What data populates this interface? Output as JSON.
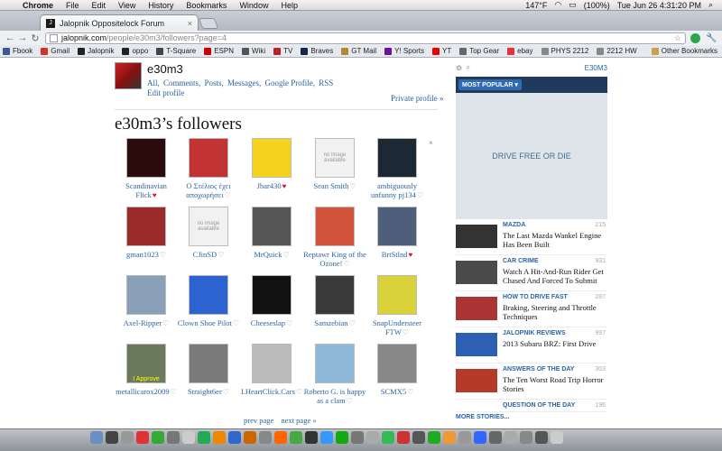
{
  "menubar": {
    "app": "Chrome",
    "menus": [
      "File",
      "Edit",
      "View",
      "History",
      "Bookmarks",
      "Window",
      "Help"
    ],
    "temp": "147°F",
    "battery": "(100%)",
    "clock": "Tue Jun 26  4:31:20 PM"
  },
  "tab": {
    "title": "Jalopnik Oppositelock Forum"
  },
  "address": {
    "host": "jalopnik.com",
    "path": "/people/e30m3/followers?page=4"
  },
  "bookmarks": [
    {
      "label": "Fbook",
      "color": "#3b5998"
    },
    {
      "label": "Gmail",
      "color": "#d93025"
    },
    {
      "label": "Jalopnik",
      "color": "#222"
    },
    {
      "label": "oppo",
      "color": "#222"
    },
    {
      "label": "T-Square",
      "color": "#444"
    },
    {
      "label": "ESPN",
      "color": "#c00"
    },
    {
      "label": "Wiki",
      "color": "#555"
    },
    {
      "label": "TV",
      "color": "#b22"
    },
    {
      "label": "Braves",
      "color": "#13274f"
    },
    {
      "label": "GT Mail",
      "color": "#b08a2e"
    },
    {
      "label": "Y! Sports",
      "color": "#720e9e"
    },
    {
      "label": "YT",
      "color": "#e00"
    },
    {
      "label": "Top Gear",
      "color": "#666"
    },
    {
      "label": "ebay",
      "color": "#e53238"
    },
    {
      "label": "PHYS 2212",
      "color": "#888"
    },
    {
      "label": "2212 HW",
      "color": "#888"
    }
  ],
  "other_bookmarks": "Other Bookmarks",
  "profile": {
    "username": "e30m3",
    "links": [
      "All,",
      "Comments,",
      "Posts,",
      "Messages,",
      "Google Profile,",
      "RSS"
    ],
    "edit": "Edit profile",
    "private": "Private profile »"
  },
  "page_title": "e30m3’s followers",
  "followers": [
    {
      "name": "Scandinavian Flick",
      "heart": "red",
      "img": "#2b0b0b"
    },
    {
      "name": "Ο Στέλιος έχει αποχωρήσει",
      "heart": "empty",
      "img": "#c23434"
    },
    {
      "name": "Jbar430",
      "heart": "red",
      "img": "#f4d21d"
    },
    {
      "name": "Sean Smith",
      "heart": "empty",
      "img": "#f1f1f1",
      "placeholder": "no image available"
    },
    {
      "name": "ambiguously unfunny pj134",
      "heart": "empty",
      "img": "#1c2834"
    },
    {
      "name": "gman1023",
      "heart": "empty",
      "img": "#9b2a2a"
    },
    {
      "name": "CJinSD",
      "heart": "empty",
      "img": "#f1f1f1",
      "placeholder": "no image available"
    },
    {
      "name": "MrQuick",
      "heart": "empty",
      "img": "#555"
    },
    {
      "name": "Reptawr King of the Ozone!",
      "heart": "empty",
      "img": "#d0533a"
    },
    {
      "name": "BrtStlnd",
      "heart": "red",
      "img": "#4e5f7e"
    },
    {
      "name": "Axel-Ripper",
      "heart": "empty",
      "img": "#8aa0b8"
    },
    {
      "name": "Clown Shoe Pilot",
      "heart": "empty",
      "img": "#2d63d0"
    },
    {
      "name": "Cheeseslap",
      "heart": "empty",
      "img": "#111"
    },
    {
      "name": "Samzebian",
      "heart": "empty",
      "img": "#3a3a3a"
    },
    {
      "name": "SnapUndersteer FTW",
      "heart": "empty",
      "img": "#d9d23a"
    },
    {
      "name": "metallicarox2009",
      "heart": "empty",
      "img": "#6a7a5a",
      "caption": "I Approve"
    },
    {
      "name": "Straight6er",
      "heart": "empty",
      "img": "#7a7a7a"
    },
    {
      "name": "I.HeartClick.Cars",
      "heart": "empty",
      "img": "#bbbbbb"
    },
    {
      "name": "Roberto G. is happy as a clam",
      "heart": "empty",
      "img": "#8fb7d8"
    },
    {
      "name": "SCMX5",
      "heart": "empty",
      "img": "#888"
    }
  ],
  "pager": {
    "prev": "prev page",
    "next": "next page »"
  },
  "sidebar": {
    "user": "E30M3",
    "most_popular": "MOST POPULAR ▾",
    "ad_text": "DRIVE FREE OR DIE",
    "stories": [
      {
        "category": "MAZDA",
        "count": "215",
        "title": "The Last Mazda Wankel Engine Has Been Built",
        "thumb": "#333"
      },
      {
        "category": "CAR CRIME",
        "count": "931",
        "title": "Watch A Hit-And-Run Rider Get Chased And Forced To Submit",
        "thumb": "#4b4b4b"
      },
      {
        "category": "HOW TO DRIVE FAST",
        "count": "287",
        "title": "Braking, Steering and Throttle Techniques",
        "thumb": "#a33"
      },
      {
        "category": "JALOPNIK REVIEWS",
        "count": "997",
        "title": "2013 Subaru BRZ: First Drive",
        "thumb": "#2d5fb3"
      },
      {
        "category": "ANSWERS OF THE DAY",
        "count": "303",
        "title": "The Ten Worst Road Trip Horror Stories",
        "thumb": "#b63a2a"
      },
      {
        "category": "QUESTION OF THE DAY",
        "count": "196",
        "title": "",
        "thumb": "#777"
      }
    ],
    "more": "MORE STORIES..."
  },
  "dock_colors": [
    "#6b8fc2",
    "#444",
    "#999",
    "#d33",
    "#3a3",
    "#777",
    "#ccc",
    "#2a5",
    "#e80",
    "#36c",
    "#c60",
    "#888",
    "#f60",
    "#4a4",
    "#333",
    "#39f",
    "#1a1",
    "#777",
    "#aaa",
    "#3b5",
    "#c33",
    "#555",
    "#2a2",
    "#e93",
    "#999",
    "#36f",
    "#666",
    "#aaa",
    "#888",
    "#555",
    "#ccc"
  ]
}
